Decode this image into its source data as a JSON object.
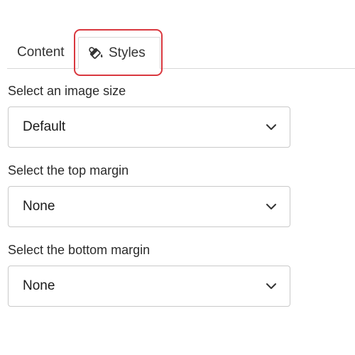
{
  "tabs": {
    "content_label": "Content",
    "styles_label": "Styles"
  },
  "fields": {
    "image_size": {
      "label": "Select an image size",
      "value": "Default"
    },
    "top_margin": {
      "label": "Select the top margin",
      "value": "None"
    },
    "bottom_margin": {
      "label": "Select the bottom margin",
      "value": "None"
    }
  },
  "icons": {
    "styles_tab_icon": "paint-bucket-icon",
    "dropdown_icon": "chevron-down-icon"
  },
  "colors": {
    "highlight": "#d9383f",
    "border": "#c9c9c9",
    "text": "#1a1a1a"
  }
}
